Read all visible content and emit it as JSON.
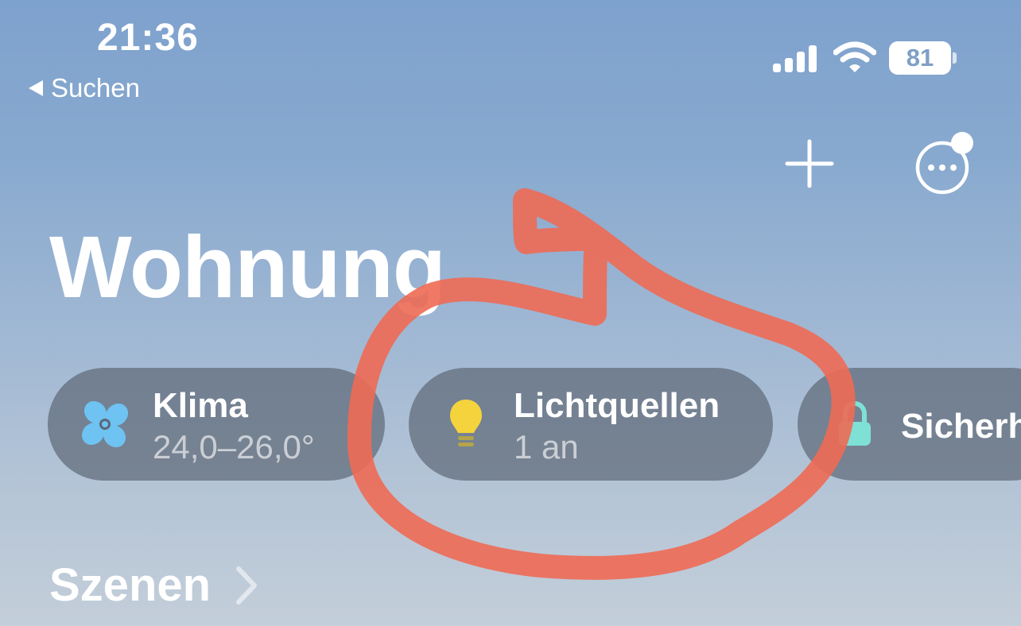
{
  "status_bar": {
    "time": "21:36",
    "back_label": "Suchen",
    "battery_level": "81",
    "icons": [
      "signal-icon",
      "wifi-icon",
      "battery-icon"
    ]
  },
  "toolbar": {
    "icons": [
      "plus-icon",
      "more-options-icon"
    ],
    "has_notification_badge": true
  },
  "page": {
    "title": "Wohnung"
  },
  "categories": [
    {
      "icon": "fan-icon",
      "title": "Klima",
      "subtitle": "24,0–26,0°",
      "icon_color": "#6ec3f2"
    },
    {
      "icon": "lightbulb-icon",
      "title": "Lichtquellen",
      "subtitle": "1 an",
      "icon_color": "#f5d33c"
    },
    {
      "icon": "lock-icon",
      "title": "Sicherh",
      "subtitle": "",
      "icon_color": "#7fe0d6"
    }
  ],
  "sections": {
    "scenes_label": "Szenen"
  },
  "annotation": {
    "color": "#ee6a54",
    "shape": "freehand-circle around Lichtquellen"
  }
}
